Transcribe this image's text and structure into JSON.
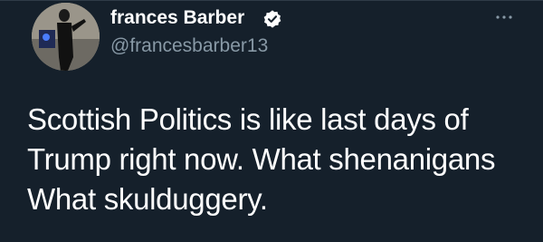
{
  "tweet": {
    "display_name": "frances Barber",
    "username": "@francesbarber13",
    "text_lines": [
      "Scottish Politics is like last days of",
      "Trump right now. What shenanigans",
      "What skulduggery."
    ],
    "verified": true,
    "icons": {
      "verified": "verified-badge-icon",
      "more": "more-options-icon"
    }
  },
  "colors": {
    "background": "#15202b",
    "primary_text": "#ffffff",
    "secondary_text": "#8899a6"
  }
}
